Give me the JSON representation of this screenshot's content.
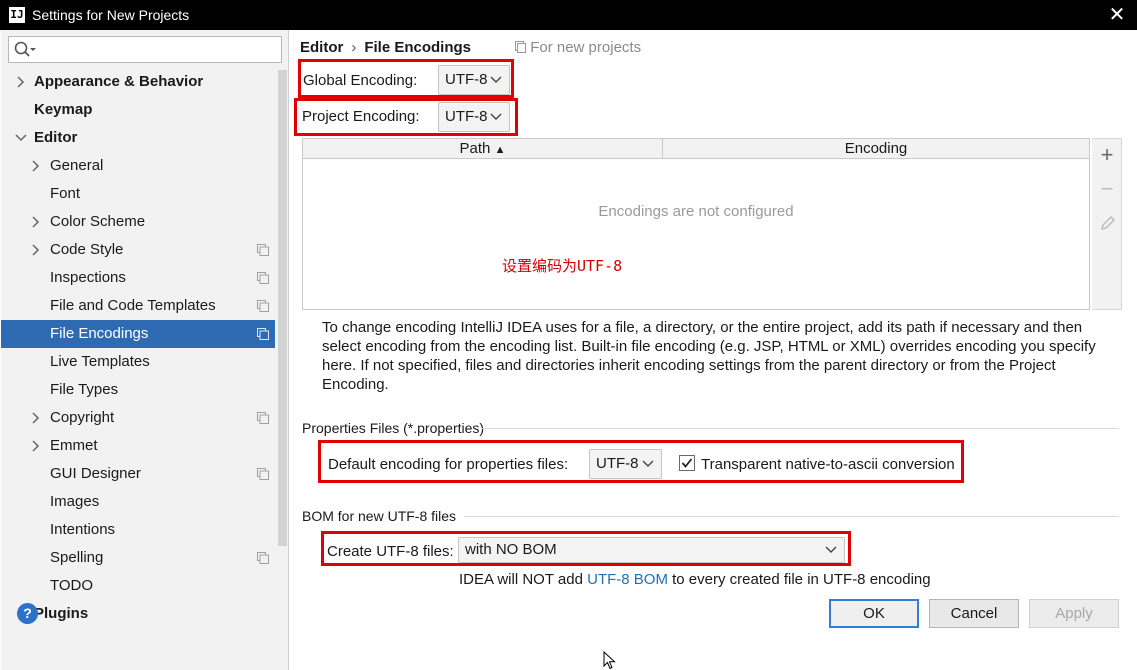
{
  "window": {
    "title": "Settings for New Projects",
    "app_icon": "IJ"
  },
  "search": {
    "value": "",
    "placeholder": ""
  },
  "sidebar": {
    "items": [
      {
        "label": "Appearance & Behavior",
        "bold": true,
        "arrow": "collapsed",
        "level": 0,
        "project_icon": false,
        "selected": false
      },
      {
        "label": "Keymap",
        "bold": true,
        "arrow": "none",
        "level": 0,
        "project_icon": false,
        "selected": false
      },
      {
        "label": "Editor",
        "bold": true,
        "arrow": "expanded",
        "level": 0,
        "project_icon": false,
        "selected": false
      },
      {
        "label": "General",
        "bold": false,
        "arrow": "collapsed",
        "level": 1,
        "project_icon": false,
        "selected": false
      },
      {
        "label": "Font",
        "bold": false,
        "arrow": "none",
        "level": 1,
        "project_icon": false,
        "selected": false
      },
      {
        "label": "Color Scheme",
        "bold": false,
        "arrow": "collapsed",
        "level": 1,
        "project_icon": false,
        "selected": false
      },
      {
        "label": "Code Style",
        "bold": false,
        "arrow": "collapsed",
        "level": 1,
        "project_icon": true,
        "selected": false
      },
      {
        "label": "Inspections",
        "bold": false,
        "arrow": "none",
        "level": 1,
        "project_icon": true,
        "selected": false
      },
      {
        "label": "File and Code Templates",
        "bold": false,
        "arrow": "none",
        "level": 1,
        "project_icon": true,
        "selected": false
      },
      {
        "label": "File Encodings",
        "bold": false,
        "arrow": "none",
        "level": 1,
        "project_icon": true,
        "selected": true
      },
      {
        "label": "Live Templates",
        "bold": false,
        "arrow": "none",
        "level": 1,
        "project_icon": false,
        "selected": false
      },
      {
        "label": "File Types",
        "bold": false,
        "arrow": "none",
        "level": 1,
        "project_icon": false,
        "selected": false
      },
      {
        "label": "Copyright",
        "bold": false,
        "arrow": "collapsed",
        "level": 1,
        "project_icon": true,
        "selected": false
      },
      {
        "label": "Emmet",
        "bold": false,
        "arrow": "collapsed",
        "level": 1,
        "project_icon": false,
        "selected": false
      },
      {
        "label": "GUI Designer",
        "bold": false,
        "arrow": "none",
        "level": 1,
        "project_icon": true,
        "selected": false
      },
      {
        "label": "Images",
        "bold": false,
        "arrow": "none",
        "level": 1,
        "project_icon": false,
        "selected": false
      },
      {
        "label": "Intentions",
        "bold": false,
        "arrow": "none",
        "level": 1,
        "project_icon": false,
        "selected": false
      },
      {
        "label": "Spelling",
        "bold": false,
        "arrow": "none",
        "level": 1,
        "project_icon": true,
        "selected": false
      },
      {
        "label": "TODO",
        "bold": false,
        "arrow": "none",
        "level": 1,
        "project_icon": false,
        "selected": false
      },
      {
        "label": "Plugins",
        "bold": true,
        "arrow": "none",
        "level": 0,
        "project_icon": false,
        "selected": false
      }
    ]
  },
  "breadcrumb": {
    "parent": "Editor",
    "separator": "›",
    "current": "File Encodings",
    "scope": "For new projects"
  },
  "global_encoding": {
    "label": "Global Encoding:",
    "value": "UTF-8"
  },
  "project_encoding": {
    "label": "Project Encoding:",
    "value": "UTF-8"
  },
  "table": {
    "columns": [
      "Path",
      "Encoding"
    ],
    "sort_indicator": "▲",
    "empty_text": "Encodings are not configured",
    "annotation": "设置编码为UTF-8",
    "toolbar": {
      "add": "+",
      "remove": "−"
    }
  },
  "description": "To change encoding IntelliJ IDEA uses for a file, a directory, or the entire project, add its path if necessary and then select encoding from the encoding list. Built-in file encoding (e.g. JSP, HTML or XML) overrides encoding you specify here. If not specified, files and directories inherit encoding settings from the parent directory or from the Project Encoding.",
  "properties": {
    "section_title": "Properties Files (*.properties)",
    "default_label": "Default encoding for properties files:",
    "default_value": "UTF-8",
    "transparent_label": "Transparent native-to-ascii conversion",
    "transparent_checked": true
  },
  "bom": {
    "section_title": "BOM for new UTF-8 files",
    "create_label": "Create UTF-8 files:",
    "create_value": "with NO BOM",
    "info_prefix": "IDEA will NOT add",
    "info_link": "UTF-8 BOM",
    "info_suffix": "to every created file in UTF-8 encoding"
  },
  "buttons": {
    "help": "?",
    "ok": "OK",
    "cancel": "Cancel",
    "apply": "Apply"
  },
  "colors": {
    "highlight_box": "#e00000",
    "selected_item": "#2f6bb3",
    "link": "#2470b3",
    "annotation_text": "#d40000"
  }
}
